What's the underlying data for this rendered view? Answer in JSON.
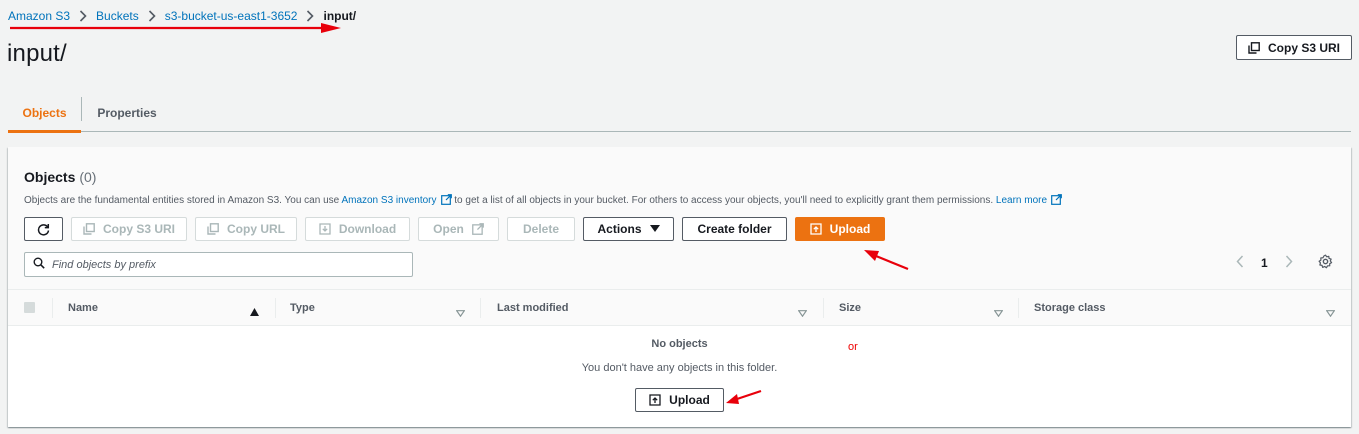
{
  "breadcrumb": {
    "items": [
      "Amazon S3",
      "Buckets",
      "s3-bucket-us-east1-3652"
    ],
    "current": "input/"
  },
  "page": {
    "title": "input/",
    "copy_s3_uri_label": "Copy S3 URI"
  },
  "tabs": [
    {
      "label": "Objects",
      "selected": true
    },
    {
      "label": "Properties",
      "selected": false
    }
  ],
  "objects_panel": {
    "title": "Objects",
    "count": "(0)",
    "description_pre": "Objects are the fundamental entities stored in Amazon S3. You can use ",
    "description_link": "Amazon S3 inventory",
    "description_mid": " to get a list of all objects in your bucket. For others to access your objects, you'll need to explicitly grant them permissions. ",
    "learn_more": "Learn more",
    "toolbar": {
      "copy_s3_uri": "Copy S3 URI",
      "copy_url": "Copy URL",
      "download": "Download",
      "open": "Open",
      "delete": "Delete",
      "actions": "Actions",
      "create_folder": "Create folder",
      "upload": "Upload"
    },
    "search_placeholder": "Find objects by prefix",
    "pagination": {
      "current_page": "1"
    },
    "columns": [
      "Name",
      "Type",
      "Last modified",
      "Size",
      "Storage class"
    ],
    "empty_title": "No objects",
    "empty_description": "You don't have any objects in this folder.",
    "empty_upload": "Upload"
  },
  "annotation": {
    "or_text": "or",
    "arrow_color": "#e8000b"
  },
  "colors": {
    "accent": "#ec7211",
    "link": "#0073bb",
    "text": "#16191f"
  }
}
